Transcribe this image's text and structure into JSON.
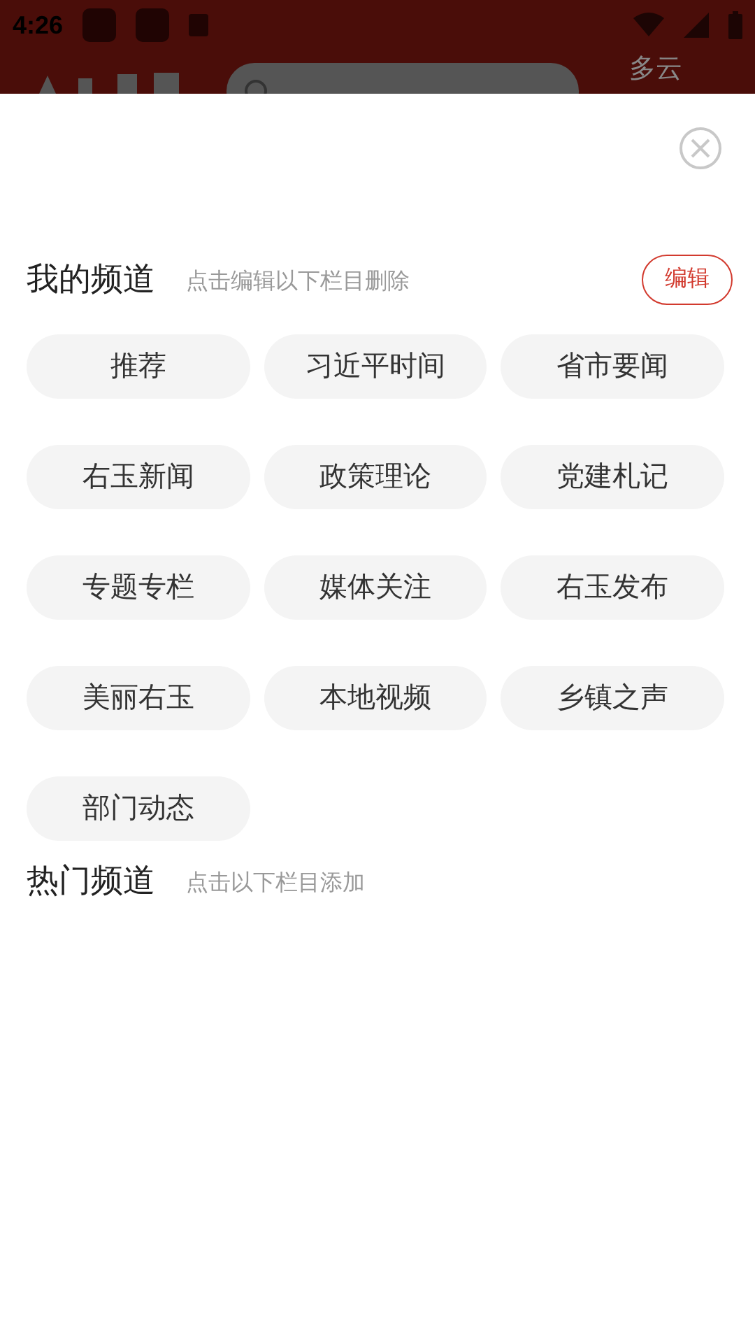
{
  "status_bar": {
    "time": "4:26"
  },
  "header": {
    "weather": "多云"
  },
  "my_channels": {
    "title": "我的频道",
    "hint": "点击编辑以下栏目删除",
    "edit_button": "编辑",
    "items": [
      {
        "label": "推荐"
      },
      {
        "label": "习近平时间"
      },
      {
        "label": "省市要闻"
      },
      {
        "label": "右玉新闻"
      },
      {
        "label": "政策理论"
      },
      {
        "label": "党建札记"
      },
      {
        "label": "专题专栏"
      },
      {
        "label": "媒体关注"
      },
      {
        "label": "右玉发布"
      },
      {
        "label": "美丽右玉"
      },
      {
        "label": "本地视频"
      },
      {
        "label": "乡镇之声"
      },
      {
        "label": "部门动态"
      }
    ]
  },
  "hot_channels": {
    "title": "热门频道",
    "hint": "点击以下栏目添加"
  }
}
